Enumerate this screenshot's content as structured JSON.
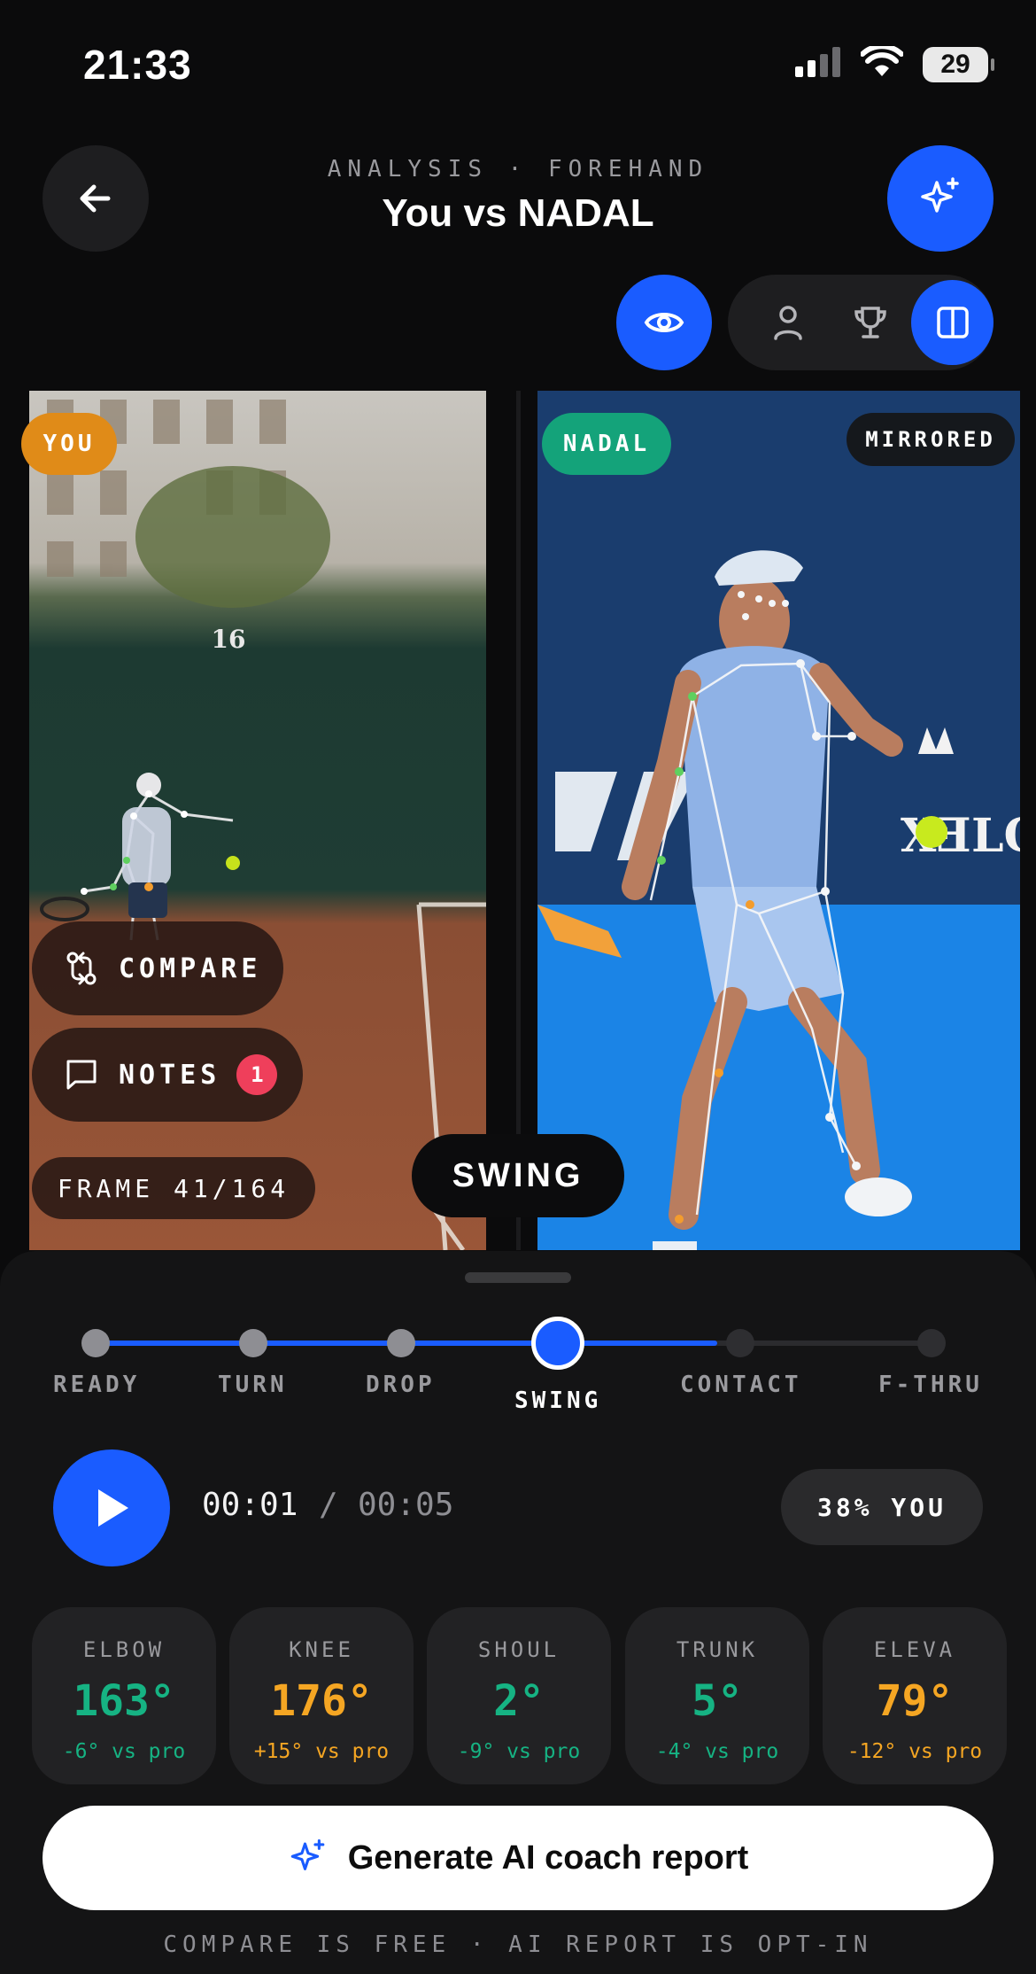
{
  "status_bar": {
    "time": "21:33",
    "battery": "29",
    "icons": [
      "signal-icon",
      "wifi-icon",
      "battery-icon"
    ]
  },
  "header": {
    "subtitle": "ANALYSIS · FOREHAND",
    "title": "You vs NADAL",
    "icons": [
      "back-arrow-icon",
      "sparkle-icon"
    ]
  },
  "view_controls": {
    "icons": [
      "eye-icon",
      "person-icon",
      "trophy-icon",
      "split-view-icon"
    ],
    "active": "split-view"
  },
  "video": {
    "left_badge": "YOU",
    "right_badge": "NADAL",
    "mirrored_label": "MIRRORED",
    "compare_label": "COMPARE",
    "notes_label": "NOTES",
    "notes_count": "1",
    "frame_label": "FRAME 41/164",
    "phase_overlay": "SWING"
  },
  "phases": {
    "items": [
      "READY",
      "TURN",
      "DROP",
      "SWING",
      "CONTACT",
      "F-THRU"
    ],
    "active": "SWING"
  },
  "playback": {
    "current": "00:01",
    "separator": "/",
    "total": "00:05",
    "percent_label": "38% YOU"
  },
  "metrics": [
    {
      "label": "ELBOW",
      "value": "163°",
      "delta": "-6° vs pro",
      "tone": "green"
    },
    {
      "label": "KNEE",
      "value": "176°",
      "delta": "+15° vs pro",
      "tone": "orange"
    },
    {
      "label": "SHOUL",
      "value": "2°",
      "delta": "-9° vs pro",
      "tone": "green"
    },
    {
      "label": "TRUNK",
      "value": "5°",
      "delta": "-4° vs pro",
      "tone": "green"
    },
    {
      "label": "ELEVA",
      "value": "79°",
      "delta": "-12° vs pro",
      "tone": "orange"
    }
  ],
  "cta": {
    "label": "Generate AI coach report"
  },
  "footer": {
    "note": "COMPARE IS FREE · AI REPORT IS OPT-IN"
  },
  "colors": {
    "accent": "#1a5cff",
    "you": "#e08b18",
    "pro": "#14a37a",
    "good": "#16b383",
    "warn": "#f5a623",
    "badge": "#ef3f5b"
  }
}
